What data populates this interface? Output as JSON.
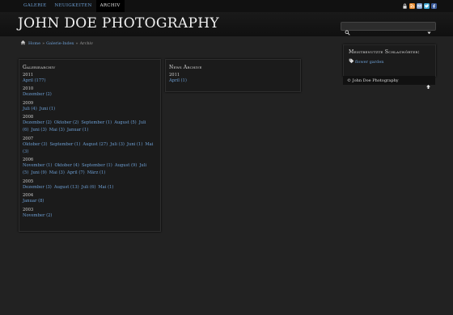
{
  "nav": {
    "items": [
      {
        "label": "GALERIE",
        "active": false
      },
      {
        "label": "NEUIGKEITEN",
        "active": false
      },
      {
        "label": "ARCHIV",
        "active": true
      }
    ]
  },
  "top_icons": [
    "lock-icon",
    "rss-icon",
    "mail-icon",
    "twitter-icon",
    "facebook-icon"
  ],
  "site": {
    "title": "JOHN DOE PHOTOGRAPHY"
  },
  "breadcrumb": {
    "home": "Home",
    "galerie": "Galerie-Index",
    "current": "Archiv",
    "separator": "»"
  },
  "gallery_archive": {
    "title": "Galeriearchiv",
    "years": [
      {
        "year": "2011",
        "months": [
          "April (177)"
        ]
      },
      {
        "year": "2010",
        "months": [
          "Dezember (2)"
        ]
      },
      {
        "year": "2009",
        "months": [
          "Juli (4)",
          "Juni (1)"
        ]
      },
      {
        "year": "2008",
        "months": [
          "Dezember (2)",
          "Oktober (2)",
          "September (1)",
          "August (5)",
          "Juli (6)",
          "Juni (3)",
          "Mai (3)",
          "Januar (1)"
        ]
      },
      {
        "year": "2007",
        "months": [
          "Oktober (3)",
          "September (1)",
          "August (27)",
          "Juli (3)",
          "Juni (1)",
          "Mai (3)"
        ]
      },
      {
        "year": "2006",
        "months": [
          "November (1)",
          "Oktober (4)",
          "September (1)",
          "August (9)",
          "Juli (5)",
          "Juni (9)",
          "Mai (3)",
          "April (7)",
          "März (1)"
        ]
      },
      {
        "year": "2005",
        "months": [
          "Dezember (3)",
          "August (13)",
          "Juli (6)",
          "Mai (1)"
        ]
      },
      {
        "year": "2004",
        "months": [
          "Januar (8)"
        ]
      },
      {
        "year": "2003",
        "months": [
          "November (2)"
        ]
      }
    ]
  },
  "news_archive": {
    "title": "News Archive",
    "years": [
      {
        "year": "2011",
        "months": [
          "April (1)"
        ]
      }
    ]
  },
  "tags": {
    "title": "Meistbenutzte Schlagwörter:",
    "items": [
      "flower garden"
    ]
  },
  "footer": {
    "copyright": "© John Doe Photography"
  },
  "colors": {
    "link": "#6d9fd4",
    "background": "#222222",
    "panel": "#1b1b1b",
    "topbar": "#111111"
  }
}
